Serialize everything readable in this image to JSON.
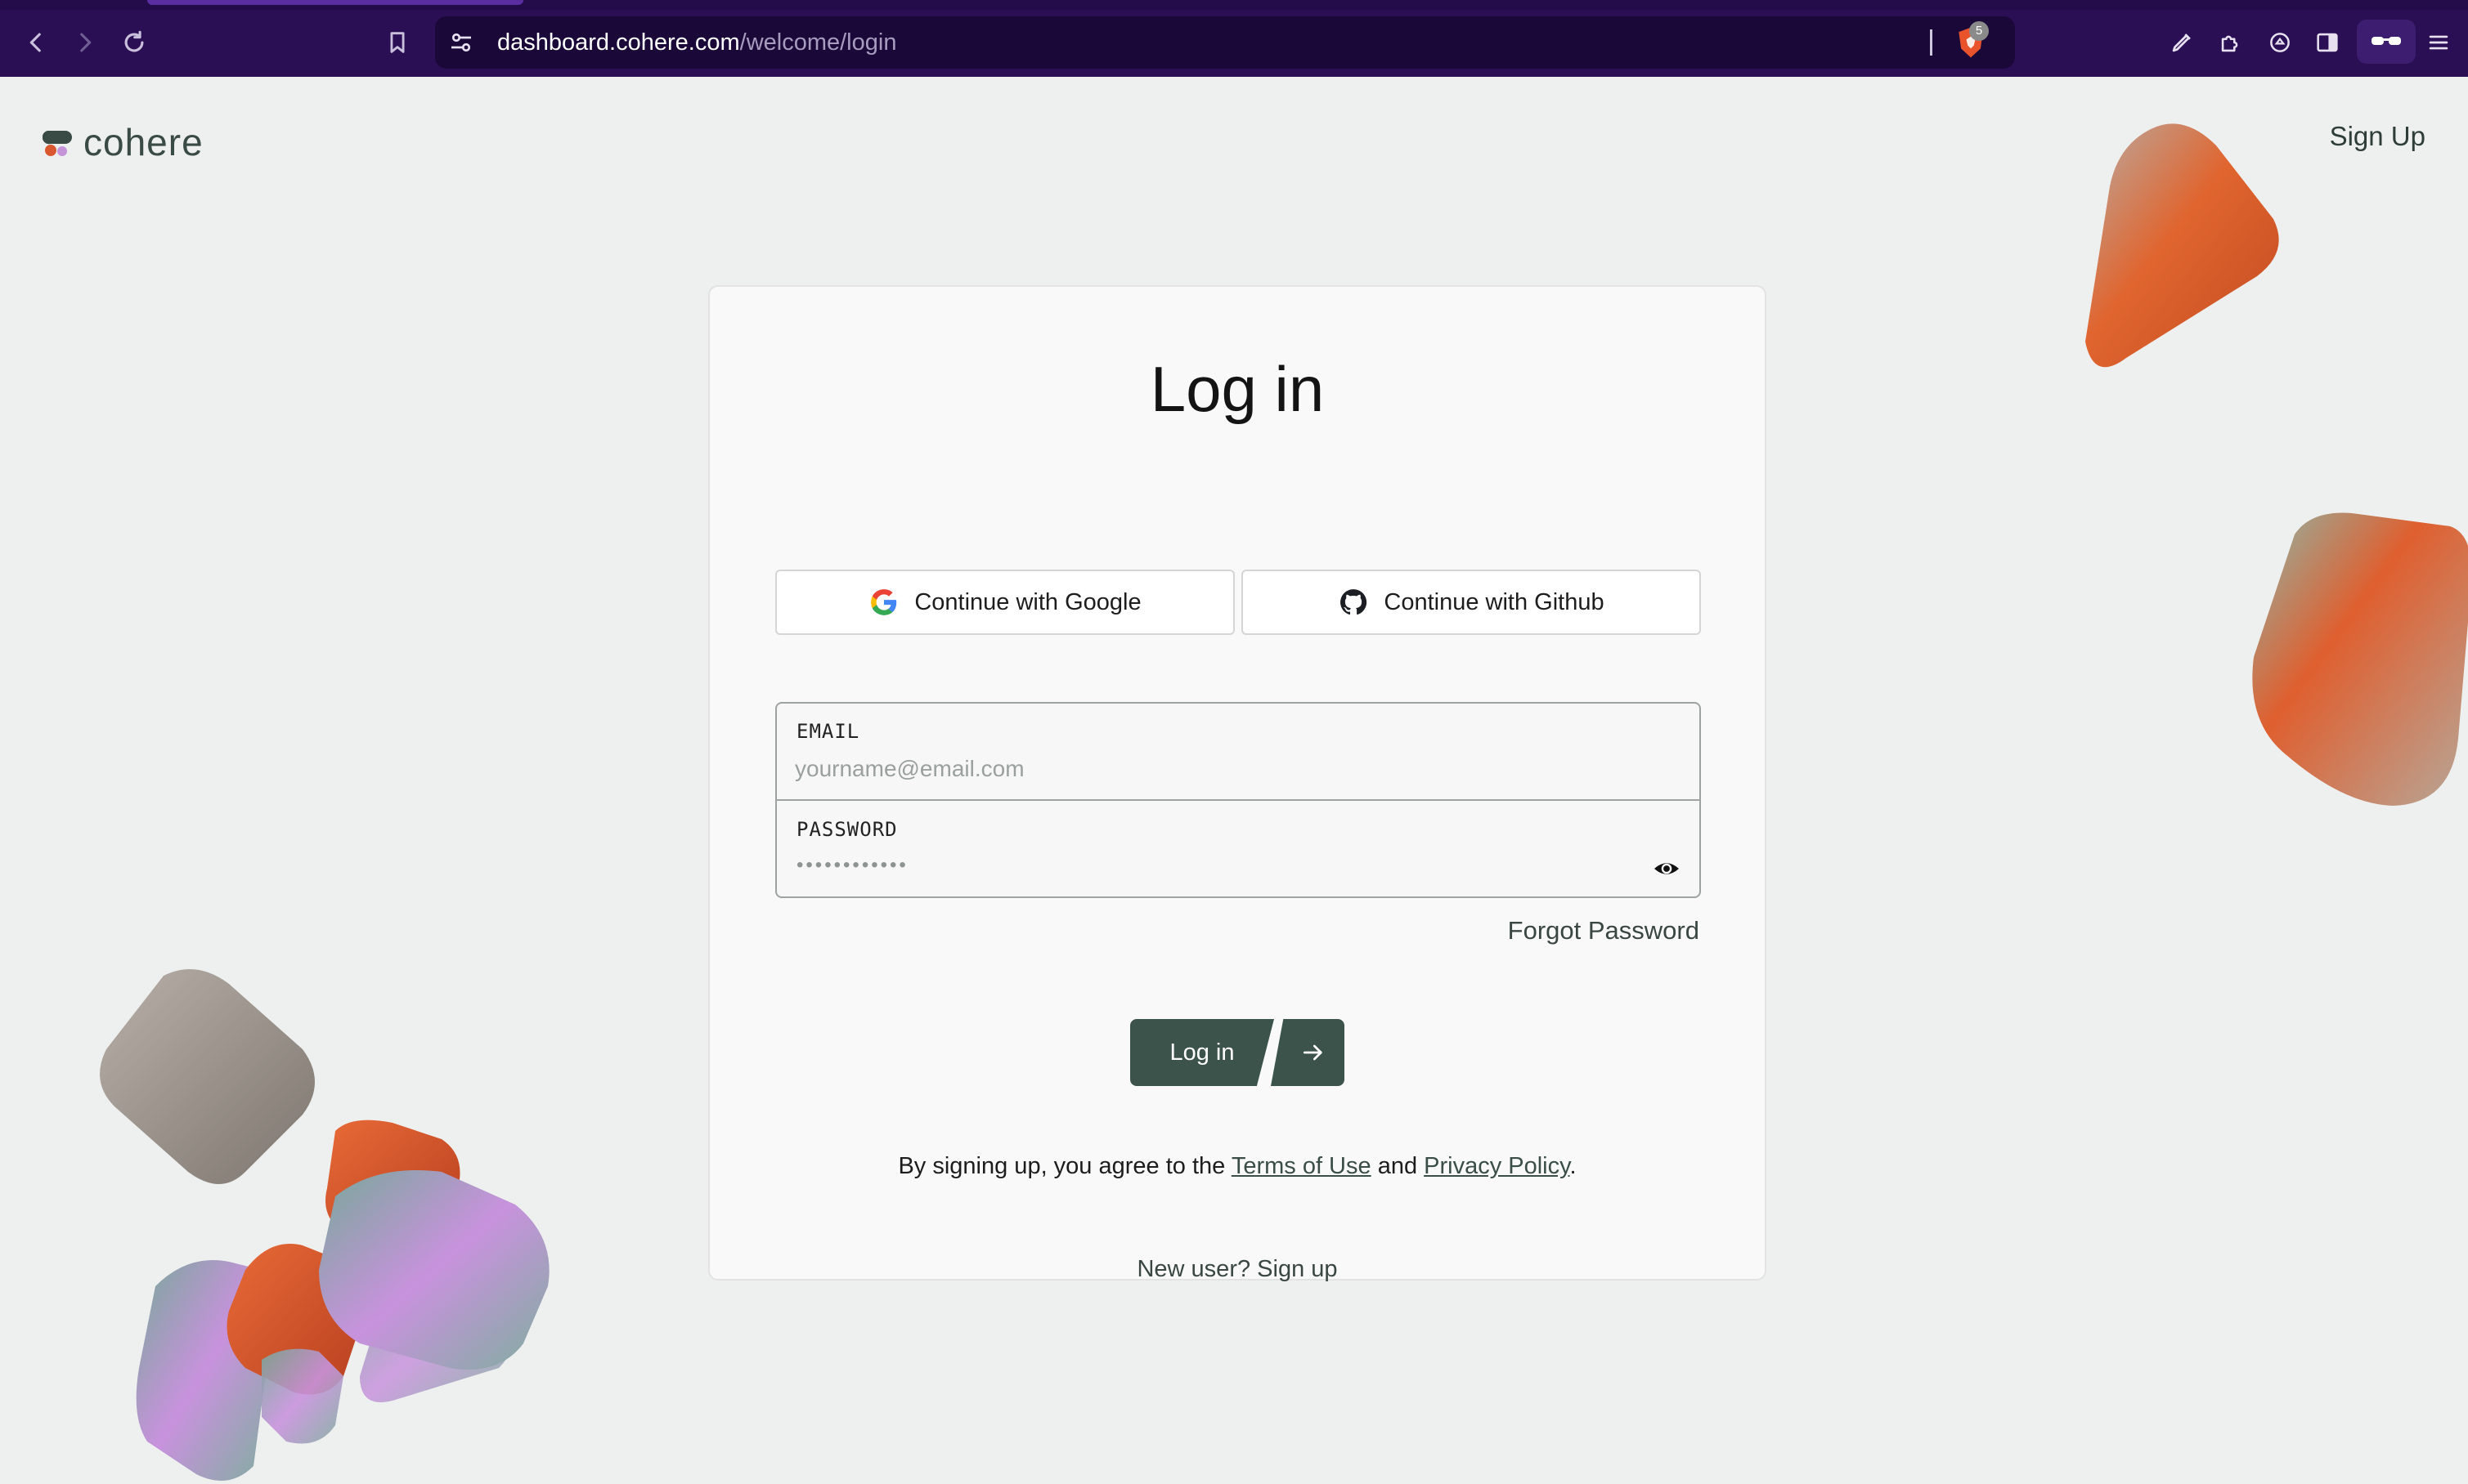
{
  "browser": {
    "url_host": "dashboard.cohere.com",
    "url_path": "/welcome/login",
    "shield_count": "5",
    "icons": {
      "back": "back-arrow-icon",
      "forward": "forward-arrow-icon",
      "reload": "reload-icon",
      "bookmark": "bookmark-icon",
      "site_settings": "site-settings-icon",
      "shield": "brave-shield-icon",
      "pen": "pen-icon",
      "extensions": "puzzle-icon",
      "leo": "leo-ai-icon",
      "sidebar": "sidebar-icon",
      "wallet": "wallet-icon",
      "menu": "hamburger-menu-icon"
    }
  },
  "header": {
    "logo_text": "cohere",
    "signup_label": "Sign Up"
  },
  "login": {
    "title": "Log in",
    "google_label": "Continue with Google",
    "github_label": "Continue with Github",
    "email_label": "EMAIL",
    "email_placeholder": "yourname@email.com",
    "password_label": "PASSWORD",
    "password_mask": "••••••••••••",
    "forgot_label": "Forgot Password",
    "submit_label": "Log in",
    "legal_prefix": "By signing up, you agree to the ",
    "terms_label": "Terms of Use",
    "legal_and": " and ",
    "privacy_label": "Privacy Policy",
    "legal_suffix": ".",
    "new_user_prefix": "New user? ",
    "new_user_link": "Sign up"
  },
  "colors": {
    "browser_bg": "#2b0f55",
    "page_bg": "#eef0ef",
    "brand_button": "#3c534b",
    "accent_orange": "#d9582f",
    "accent_lilac": "#c493d8",
    "accent_teal": "#7fa89a"
  }
}
